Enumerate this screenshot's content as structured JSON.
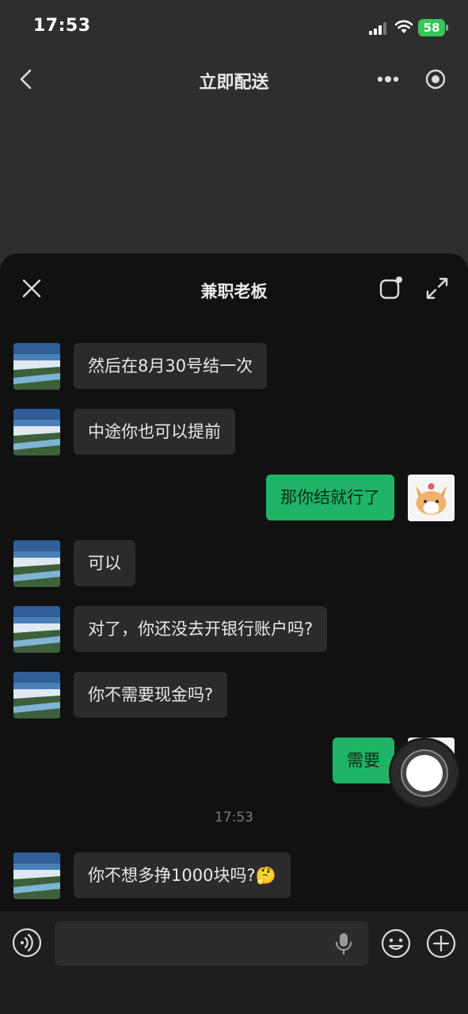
{
  "status_bar": {
    "time": "17:53",
    "battery": "58"
  },
  "nav": {
    "title": "立即配送"
  },
  "sheet": {
    "title": "兼职老板"
  },
  "messages": [
    {
      "side": "left",
      "text": "然后在8月30号结一次"
    },
    {
      "side": "left",
      "text": "中途你也可以提前"
    },
    {
      "side": "right",
      "text": "那你结就行了"
    },
    {
      "side": "left",
      "text": "可以"
    },
    {
      "side": "left",
      "text": "对了，你还没去开银行账户吗?"
    },
    {
      "side": "left",
      "text": "你不需要现金吗?"
    },
    {
      "side": "right",
      "text": "需要"
    },
    {
      "side": "left",
      "text": "你不想多挣1000块吗?",
      "emoji": "🤔"
    }
  ],
  "timestamp": "17:53",
  "colors": {
    "sent_bubble": "#1fb465",
    "received_bubble": "#2b2b2b",
    "sheet_bg": "#111111"
  },
  "icons": [
    "back-icon",
    "more-icon",
    "target-icon",
    "close-icon",
    "compose-icon",
    "expand-icon",
    "voice-icon",
    "mic-icon",
    "emoji-icon",
    "plus-icon"
  ]
}
